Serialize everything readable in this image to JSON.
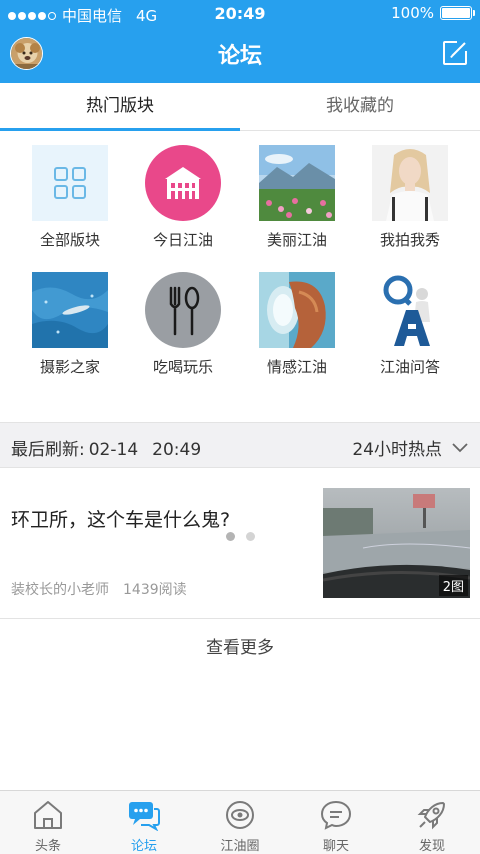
{
  "status_bar": {
    "carrier": "中国电信",
    "network": "4G",
    "time": "20:49",
    "battery": "100%",
    "battery_level": 1.0
  },
  "header": {
    "title": "论坛",
    "color": "#27a0ee"
  },
  "tabs": [
    {
      "label": "热门版块",
      "active": true
    },
    {
      "label": "我收藏的",
      "active": false
    }
  ],
  "boards": [
    {
      "label": "全部版块",
      "icon": "grid-icon"
    },
    {
      "label": "今日江油",
      "icon": "house-icon"
    },
    {
      "label": "美丽江油",
      "icon": "landscape-photo"
    },
    {
      "label": "我拍我秀",
      "icon": "portrait-photo"
    },
    {
      "label": "摄影之家",
      "icon": "water-photo"
    },
    {
      "label": "吃喝玩乐",
      "icon": "fork-spoon-icon"
    },
    {
      "label": "情感江油",
      "icon": "emotion-photo"
    },
    {
      "label": "江油问答",
      "icon": "qa-figure-icon"
    }
  ],
  "pager": {
    "pages": 2,
    "current": 1
  },
  "refresh_bar": {
    "label": "最后刷新:",
    "date": "02-14",
    "time": "20:49",
    "filter": "24小时热点"
  },
  "post": {
    "title": "环卫所，这个车是什么鬼?",
    "author": "装校长的小老师",
    "reads": "1439阅读",
    "image_count": "2图"
  },
  "more_label": "查看更多",
  "bottom_nav": [
    {
      "label": "头条",
      "icon": "home-icon",
      "active": false
    },
    {
      "label": "论坛",
      "icon": "forum-chat-icon",
      "active": true
    },
    {
      "label": "江油圈",
      "icon": "circle-eye-icon",
      "active": false
    },
    {
      "label": "聊天",
      "icon": "chat-bubble-icon",
      "active": false
    },
    {
      "label": "发现",
      "icon": "rocket-icon",
      "active": false
    }
  ]
}
